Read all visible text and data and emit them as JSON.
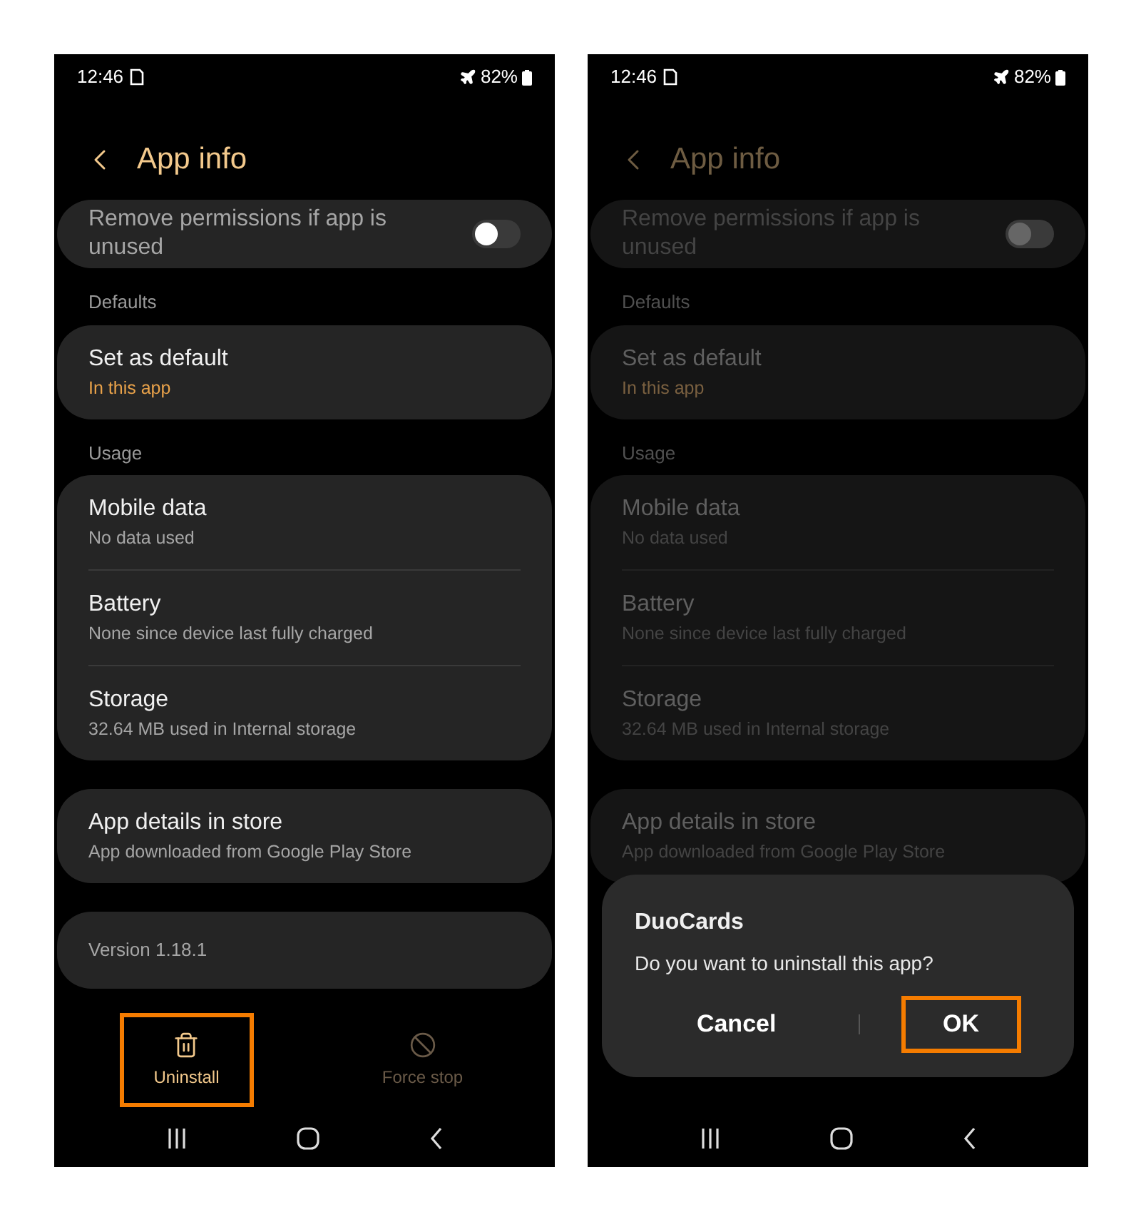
{
  "screens": [
    {
      "dimmed": false,
      "status_bar": {
        "time": "12:46",
        "battery": "82%"
      },
      "header": {
        "title": "App info"
      },
      "toggle_row": {
        "label": "Remove permissions if app is unused",
        "on": false
      },
      "sections": [
        {
          "heading": "Defaults",
          "items": [
            {
              "title": "Set as default",
              "subtitle": "In this app",
              "accent": true
            }
          ]
        },
        {
          "heading": "Usage",
          "items": [
            {
              "title": "Mobile data",
              "subtitle": "No data used",
              "accent": false
            },
            {
              "title": "Battery",
              "subtitle": "None since device last fully charged",
              "accent": false
            },
            {
              "title": "Storage",
              "subtitle": "32.64 MB used in Internal storage",
              "accent": false
            }
          ]
        },
        {
          "items": [
            {
              "title": "App details in store",
              "subtitle": "App downloaded from Google Play Store",
              "accent": false
            }
          ]
        }
      ],
      "version": "Version 1.18.1",
      "actions": [
        {
          "kind": "uninstall",
          "label": "Uninstall",
          "disabled": false,
          "highlighted": true
        },
        {
          "kind": "force-stop",
          "label": "Force stop",
          "disabled": true,
          "highlighted": false
        }
      ]
    },
    {
      "dimmed": true,
      "status_bar": {
        "time": "12:46",
        "battery": "82%"
      },
      "header": {
        "title": "App info"
      },
      "toggle_row": {
        "label": "Remove permissions if app is unused",
        "on": false
      },
      "sections": [
        {
          "heading": "Defaults",
          "items": [
            {
              "title": "Set as default",
              "subtitle": "In this app",
              "accent": true
            }
          ]
        },
        {
          "heading": "Usage",
          "items": [
            {
              "title": "Mobile data",
              "subtitle": "No data used",
              "accent": false
            },
            {
              "title": "Battery",
              "subtitle": "None since device last fully charged",
              "accent": false
            },
            {
              "title": "Storage",
              "subtitle": "32.64 MB used in Internal storage",
              "accent": false
            }
          ]
        },
        {
          "items": [
            {
              "title": "App details in store",
              "subtitle": "App downloaded from Google Play Store",
              "accent": false
            }
          ]
        }
      ],
      "dialog": {
        "title": "DuoCards",
        "message": "Do you want to uninstall this app?",
        "buttons": [
          {
            "label": "Cancel",
            "highlighted": false
          },
          {
            "label": "OK",
            "highlighted": true
          }
        ]
      }
    }
  ]
}
